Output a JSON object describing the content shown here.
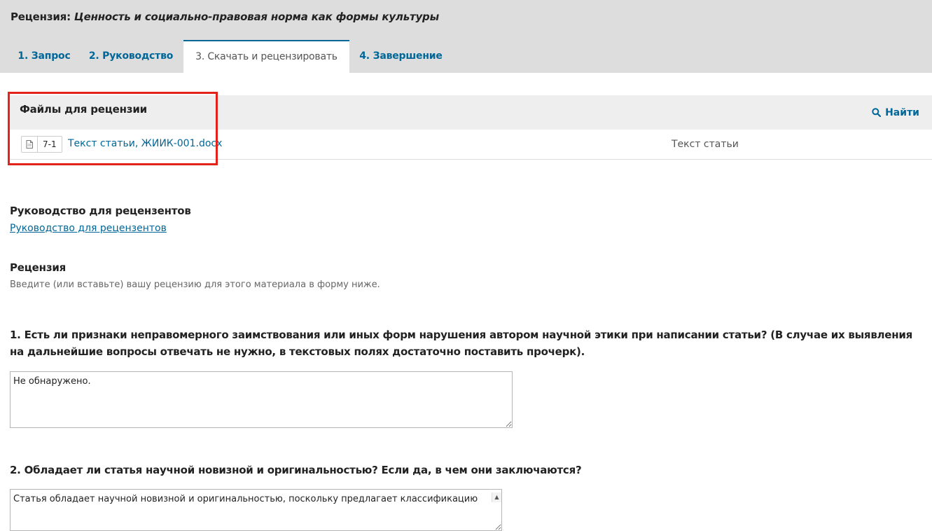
{
  "header": {
    "title_prefix": "Рецензия: ",
    "title_name": "Ценность и социально-правовая норма как формы культуры"
  },
  "tabs": [
    {
      "label": "1. Запрос"
    },
    {
      "label": "2. Руководство"
    },
    {
      "label": "3. Скачать и рецензировать"
    },
    {
      "label": "4. Завершение"
    }
  ],
  "active_tab": "3. Скачать и рецензировать",
  "files": {
    "title": "Файлы для рецензии",
    "find_label": "Найти",
    "items": [
      {
        "id": "7-1",
        "name": "Текст статьи, ЖИИК-001.docx",
        "type": "Текст статьи",
        "icon": "document-icon"
      }
    ]
  },
  "guidelines": {
    "heading": "Руководство для рецензентов",
    "link": "Руководство для рецензентов"
  },
  "review": {
    "heading": "Рецензия",
    "description": "Введите (или вставьте) вашу рецензию для этого материала в форму ниже."
  },
  "questions": [
    {
      "text": "1. Есть ли признаки неправомерного заимствования или иных форм нарушения автором научной этики при написании статьи? (В случае их выявления на дальнейшие вопросы отвечать не нужно, в текстовых полях достаточно поставить прочерк).",
      "answer": "Не обнаружено."
    },
    {
      "text": "2. Обладает ли статья научной новизной и оригинальностью? Если да, в чем они заключаются?",
      "answer": "Статья обладает научной новизной и оригинальностью, поскольку предлагает классификацию"
    }
  ],
  "colors": {
    "accent": "#006798",
    "highlight": "#e2231a",
    "header_bg": "#dddddd"
  }
}
